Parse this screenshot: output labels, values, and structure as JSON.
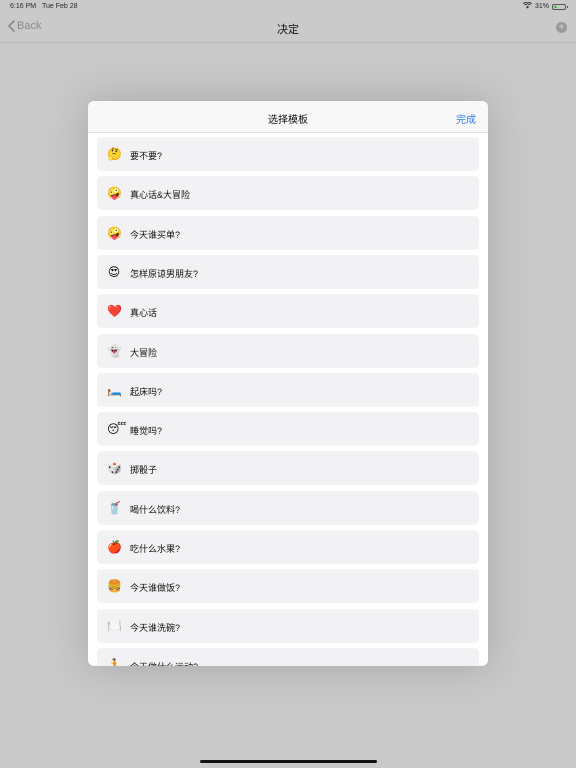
{
  "status": {
    "time": "6:16 PM",
    "date": "Tue Feb 28",
    "battery": "31%",
    "battery_level": 0.31
  },
  "nav": {
    "back_label": "Back",
    "title": "决定",
    "add_icon": "plus-circle-icon"
  },
  "sheet": {
    "title": "选择模板",
    "done_label": "完成",
    "items": [
      {
        "emoji": "🤔",
        "icon": "thinking-face-icon",
        "label": "要不要?"
      },
      {
        "emoji": "🤪",
        "icon": "zany-face-icon",
        "label": "真心话&大冒险"
      },
      {
        "emoji": "🤪",
        "icon": "zany-face-icon",
        "label": "今天谁买单?"
      },
      {
        "emoji": "😍",
        "icon": "heart-eyes-face-icon",
        "label": "怎样原谅男朋友?"
      },
      {
        "emoji": "❤️",
        "icon": "red-heart-icon",
        "label": "真心话"
      },
      {
        "emoji": "👻",
        "icon": "ghost-icon",
        "label": "大冒险"
      },
      {
        "emoji": "🛏️",
        "icon": "bed-icon",
        "label": "起床吗?"
      },
      {
        "emoji": "😴",
        "icon": "sleeping-face-icon",
        "label": "睡觉吗?"
      },
      {
        "emoji": "🎲",
        "icon": "dice-icon",
        "label": "掷骰子"
      },
      {
        "emoji": "🥤",
        "icon": "drink-cup-icon",
        "label": "喝什么饮料?"
      },
      {
        "emoji": "🍎",
        "icon": "red-apple-icon",
        "label": "吃什么水果?"
      },
      {
        "emoji": "🍔",
        "icon": "hamburger-icon",
        "label": "今天谁做饭?"
      },
      {
        "emoji": "🍽️",
        "icon": "plate-icon",
        "label": "今天谁洗碗?"
      },
      {
        "emoji": "🏃",
        "icon": "running-person-icon",
        "label": "今天做什么运动?"
      }
    ]
  }
}
